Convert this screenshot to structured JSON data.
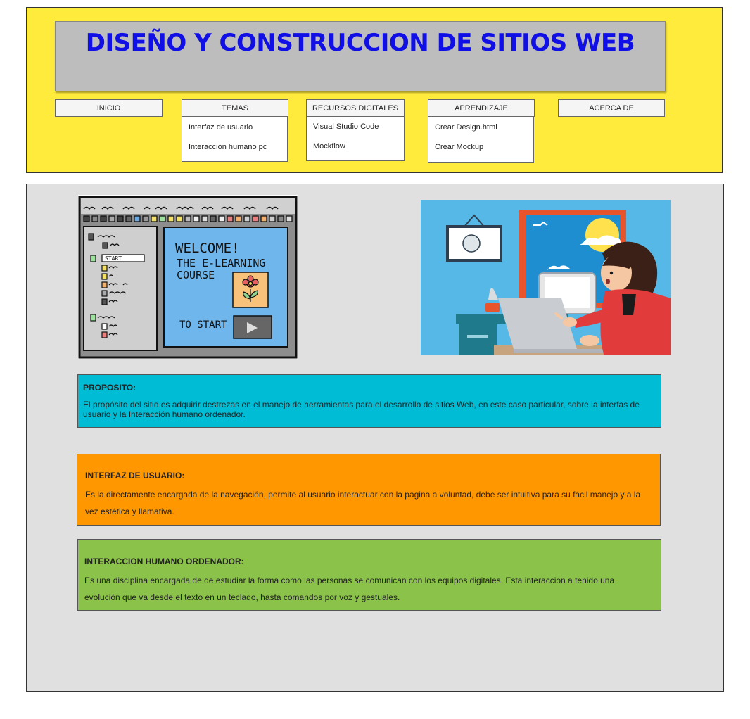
{
  "header": {
    "title": "DISEÑO Y CONSTRUCCION DE SITIOS WEB"
  },
  "nav": {
    "inicio": "INICIO",
    "temas": "TEMAS",
    "recursos": "RECURSOS DIGITALES",
    "aprendizaje": "APRENDIZAJE",
    "acerca": "ACERCA DE",
    "temas_items": [
      "Interfaz de usuario",
      "Interacción humano pc"
    ],
    "recursos_items": [
      "Visual Studio Code",
      "Mockflow"
    ],
    "aprendizaje_items": [
      "Crear Design.html",
      "Crear Mockup"
    ]
  },
  "elearning_image": {
    "line1": "WELCOME!",
    "line2": "THE E-LEARNING",
    "line3": "COURSE",
    "start_text": "TO START",
    "tree_start": "START"
  },
  "proposito": {
    "title": "PROPOSITO:",
    "text": "El propósito del sitio es adquirir destrezas en el manejo de herramientas para el desarrollo de sitios Web, en este caso particular, sobre la interfas de usuario y la Interacción  humano ordenador.",
    "color": "#00bcd4"
  },
  "interfaz": {
    "title": "INTERFAZ DE USUARIO:",
    "text": "Es la directamente encargada de la navegación, permite al usuario interactuar con la pagina a voluntad, debe ser intuitiva para su fácil manejo y a la vez estética y llamativa.",
    "color": "#ff9800"
  },
  "interaccion": {
    "title": "INTERACCION HUMANO ORDENADOR:",
    "text": "Es una disciplina encargada de de estudiar la forma como las personas se comunican con los equipos digitales. Esta interaccion a tenido una evolución que va desde el texto en un teclado, hasta comandos por voz y gestuales.",
    "color": "#8bc34a"
  },
  "colors": {
    "header_bg": "#ffeb3b",
    "title_color": "#1010e6",
    "main_bg": "#e0e0e0"
  }
}
